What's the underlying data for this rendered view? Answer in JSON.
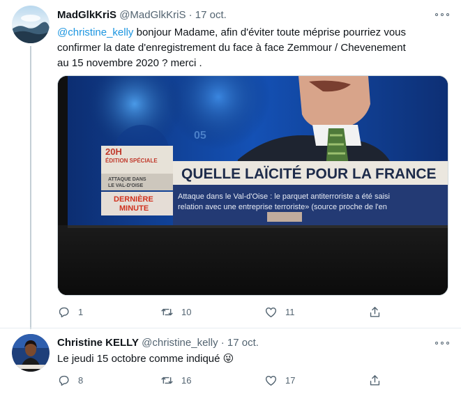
{
  "tweets": [
    {
      "display_name": "MadGlkKriS",
      "handle": "@MadGlkKriS",
      "separator": "·",
      "date": "17 oct.",
      "text_mention": "@christine_kelly",
      "text_line1_rest": " bonjour Madame, afin d'éviter toute méprise pourriez vous",
      "text_line2": "confirmer la date d'enregistrement du face à face Zemmour / Chevenement",
      "text_line3": "au 15 novembre 2020 ? merci .",
      "media": {
        "banner_time": "20H",
        "banner_edition": "ÉDITION SPÉCIALE",
        "banner_topic_line1": "ATTAQUE DANS",
        "banner_topic_line2": "LE VAL-D'OISE",
        "breaking_line1": "DERNIÈRE",
        "breaking_line2": "MINUTE",
        "headline": "QUELLE LAÏCITÉ POUR LA FRANCE",
        "ticker_line1": "Attaque dans le Val-d'Oise : le parquet antiterroriste a été saisi",
        "ticker_line2": "relation avec une entreprise terroriste» (source proche de l'en",
        "screen_number": "05"
      },
      "actions": {
        "replies": "1",
        "retweets": "10",
        "likes": "11"
      }
    },
    {
      "display_name": "Christine KELLY",
      "handle": "@christine_kelly",
      "separator": "·",
      "date": "17 oct.",
      "text": "Le jeudi 15 octobre comme indiqué ",
      "emoji": "😜",
      "actions": {
        "replies": "8",
        "retweets": "16",
        "likes": "17"
      }
    }
  ],
  "icons": [
    "reply-icon",
    "retweet-icon",
    "like-icon",
    "share-icon",
    "more-options-icon"
  ],
  "colors": {
    "link": "#1b95e0",
    "secondary_text": "#536471",
    "thread_line": "#c4cfd6",
    "divider": "#e6ecf0"
  }
}
